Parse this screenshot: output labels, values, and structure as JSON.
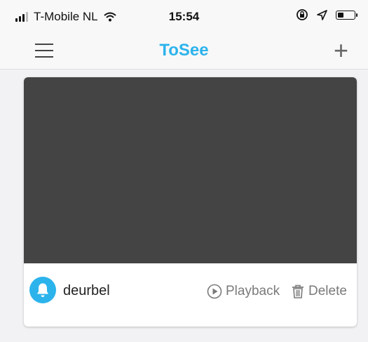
{
  "status_bar": {
    "carrier": "T-Mobile NL",
    "time": "15:54",
    "icons": [
      "signal-icon",
      "wifi-icon",
      "orientation-lock-icon",
      "location-icon",
      "battery-icon"
    ]
  },
  "header": {
    "title": "ToSee",
    "menu_icon": "menu-icon",
    "add_icon": "plus-icon"
  },
  "devices": [
    {
      "name": "deurbel",
      "icon": "bell-icon",
      "playback_label": "Playback",
      "delete_label": "Delete"
    }
  ],
  "colors": {
    "accent": "#2cb3ec",
    "video_placeholder": "#444444",
    "background": "#f2f2f4"
  }
}
